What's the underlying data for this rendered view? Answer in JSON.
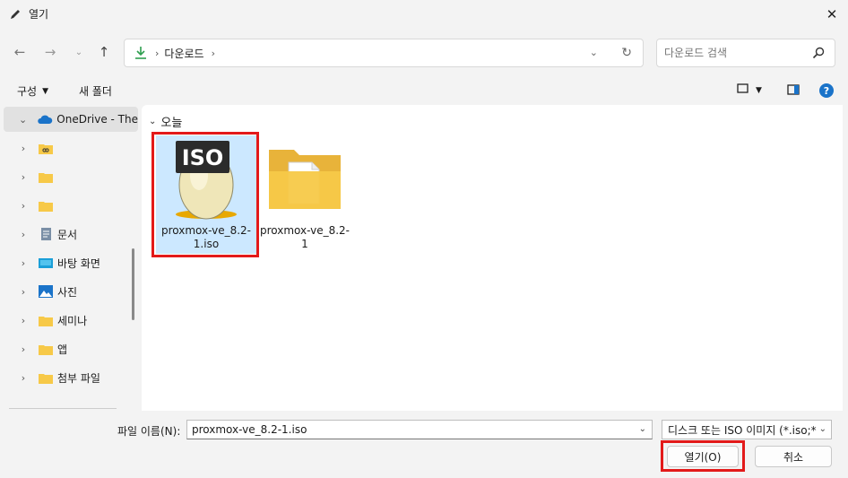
{
  "window": {
    "title": "열기",
    "close_glyph": "✕"
  },
  "nav": {
    "back_glyph": "←",
    "forward_glyph": "→",
    "recent_glyph": "⌄",
    "up_glyph": "↑",
    "breadcrumb_separator": "›",
    "breadcrumb": "다운로드",
    "breadcrumb_trailing": "›",
    "address_dropdown_glyph": "⌄",
    "refresh_glyph": "↻"
  },
  "search": {
    "placeholder": "다운로드 검색"
  },
  "toolbar": {
    "organize_label": "구성",
    "organize_caret": "▼",
    "new_folder_label": "새 폴더",
    "view_caret": "▼",
    "help_glyph": "?"
  },
  "sidebar": {
    "items": [
      {
        "label": "OneDrive - The",
        "icon": "cloud-icon",
        "expanded": true
      },
      {
        "label": "",
        "icon": "folder-link-icon"
      },
      {
        "label": "",
        "icon": "folder-icon"
      },
      {
        "label": "",
        "icon": "folder-icon"
      },
      {
        "label": "문서",
        "icon": "document-icon"
      },
      {
        "label": "바탕 화면",
        "icon": "desktop-icon"
      },
      {
        "label": "사진",
        "icon": "pictures-icon"
      },
      {
        "label": "세미나",
        "icon": "folder-icon"
      },
      {
        "label": "앱",
        "icon": "folder-icon"
      },
      {
        "label": "첨부 파일",
        "icon": "folder-icon"
      }
    ],
    "collapsed_glyph": "›",
    "expanded_glyph": "⌄"
  },
  "content": {
    "group_chevron": "⌄",
    "group_label": "오늘",
    "files": [
      {
        "name": "proxmox-ve_8.2-1.iso",
        "icon": "iso-disc-icon",
        "icon_text": "ISO",
        "selected": true
      },
      {
        "name": "proxmox-ve_8.2-1",
        "icon": "folder-icon",
        "selected": false
      }
    ]
  },
  "footer": {
    "filename_label": "파일 이름(N):",
    "filename_value": "proxmox-ve_8.2-1.iso",
    "dropdown_glyph": "⌄",
    "filetype_value": "디스크 또는 ISO 이미지 (*.iso;*",
    "open_label": "열기(O)",
    "cancel_label": "취소"
  },
  "colors": {
    "accent": "#1a73c9",
    "highlight_box": "#e31a1a",
    "selection": "#cce8ff",
    "folder": "#f7c948"
  }
}
